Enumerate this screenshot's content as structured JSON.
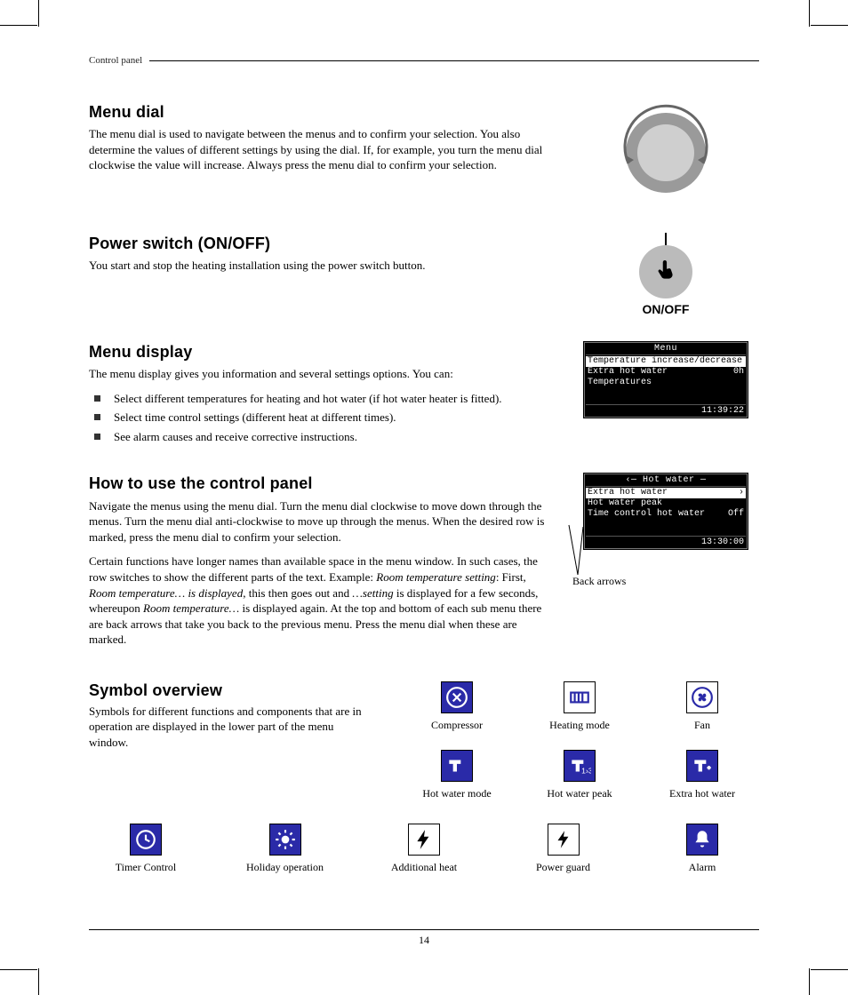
{
  "runningHead": "Control panel",
  "pageNumber": "14",
  "menuDial": {
    "heading": "Menu dial",
    "body": "The menu dial is used to navigate between the menus and to confirm your selection. You also determine the values of different settings by using the dial. If, for example, you turn the menu dial clockwise the value will increase. Always press the menu dial to confirm your selection."
  },
  "powerSwitch": {
    "heading": "Power switch (ON/OFF)",
    "body": "You start and stop the heating installation using the power switch button.",
    "label": "ON/OFF"
  },
  "menuDisplay": {
    "heading": "Menu display",
    "intro": "The menu display gives you information and several settings options. You can:",
    "items": [
      "Select different temperatures for heating and hot water (if hot water heater is fitted).",
      "Select time control settings (different heat at different times).",
      "See alarm causes and receive corrective instructions."
    ],
    "lcd": {
      "title": "Menu",
      "rows": [
        {
          "l": "Temperature increase/decrease",
          "r": "",
          "sel": true
        },
        {
          "l": "Extra hot water",
          "r": "0h",
          "sel": false
        },
        {
          "l": "Temperatures",
          "r": "",
          "sel": false
        }
      ],
      "time": "11:39:22"
    }
  },
  "howTo": {
    "heading": "How to use the control panel",
    "p1": "Navigate the menus using the menu dial. Turn the menu dial clockwise to move down through the menus. Turn the menu dial anti-clockwise to move up through the menus. When the desired row is marked, press the menu dial to confirm your selection.",
    "p2a": "Certain functions have longer names than available space in the menu window. In such cases, the row switches to show the different parts of the text. Example: ",
    "p2b": "Room temperature setting",
    "p2c": ": First, ",
    "p2d": "Room temperature… is displayed",
    "p2e": ", this then goes out and ",
    "p2f": "…setting",
    "p2g": " is displayed for a few seconds, whereupon ",
    "p2h": "Room temperature…",
    "p2i": " is displayed again. At the top and bottom of each sub menu there are back arrows that take you back to the previous menu. Press the menu dial when these are marked.",
    "lcd": {
      "title": "Hot water",
      "rows": [
        {
          "l": "Extra hot water",
          "r": "›",
          "sel": true
        },
        {
          "l": "Hot water peak",
          "r": "",
          "sel": false
        },
        {
          "l": "Time control hot water",
          "r": "Off",
          "sel": false
        }
      ],
      "time": "13:30:00"
    },
    "backArrows": "Back arrows"
  },
  "symbols": {
    "heading": "Symbol overview",
    "body": "Symbols for different functions and components that are in operation are displayed in the lower part of the menu window.",
    "row1": [
      "Compressor",
      "Heating mode",
      "Fan"
    ],
    "row2": [
      "Hot water mode",
      "Hot water peak",
      "Extra hot water"
    ],
    "row3": [
      "Timer Control",
      "Holiday operation",
      "Additional heat",
      "Power guard",
      "Alarm"
    ]
  }
}
